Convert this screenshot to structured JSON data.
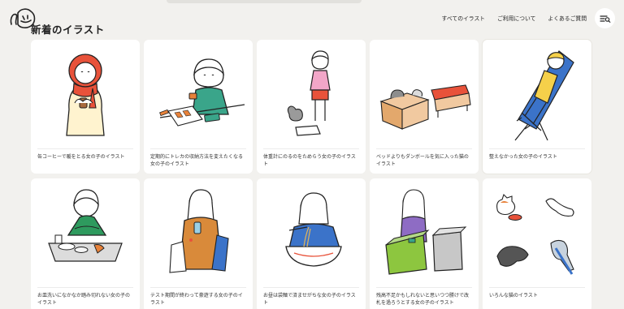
{
  "header": {
    "page_title": "新着のイラスト",
    "nav": [
      "すべてのイラスト",
      "ご利用について",
      "よくあるご質問"
    ]
  },
  "cards": [
    {
      "caption": "缶コーヒーで暖をとる女の子のイラスト",
      "accent": "#e8523a"
    },
    {
      "caption": "定期的にトレカの収納方法を変えたくなる女の子のイラスト",
      "accent": "#3aa58a"
    },
    {
      "caption": "体重計にのるのをためらう女の子のイラスト",
      "accent": "#f2a6c8"
    },
    {
      "caption": "ベッドよりもダンボールを気に入った猫のイラスト",
      "accent": "#e8523a"
    },
    {
      "caption": "整えなかった女の子のイラスト",
      "accent": "#3b73c9"
    },
    {
      "caption": "お皿洗いになかなか踏み切れない女の子のイラスト",
      "accent": "#2e9a5e"
    },
    {
      "caption": "テスト期間が終わって豪遊する女の子のイラスト",
      "accent": "#d98a3a"
    },
    {
      "caption": "お昼は袋麺で済ませがちな女の子のイラスト",
      "accent": "#3b73c9"
    },
    {
      "caption": "残高不足かもしれないと思いつつ勝けで改札を過ろうとする女の子のイラスト",
      "accent": "#8dc63f"
    },
    {
      "caption": "いろんな猫のイラスト",
      "accent": "#e8523a"
    }
  ]
}
